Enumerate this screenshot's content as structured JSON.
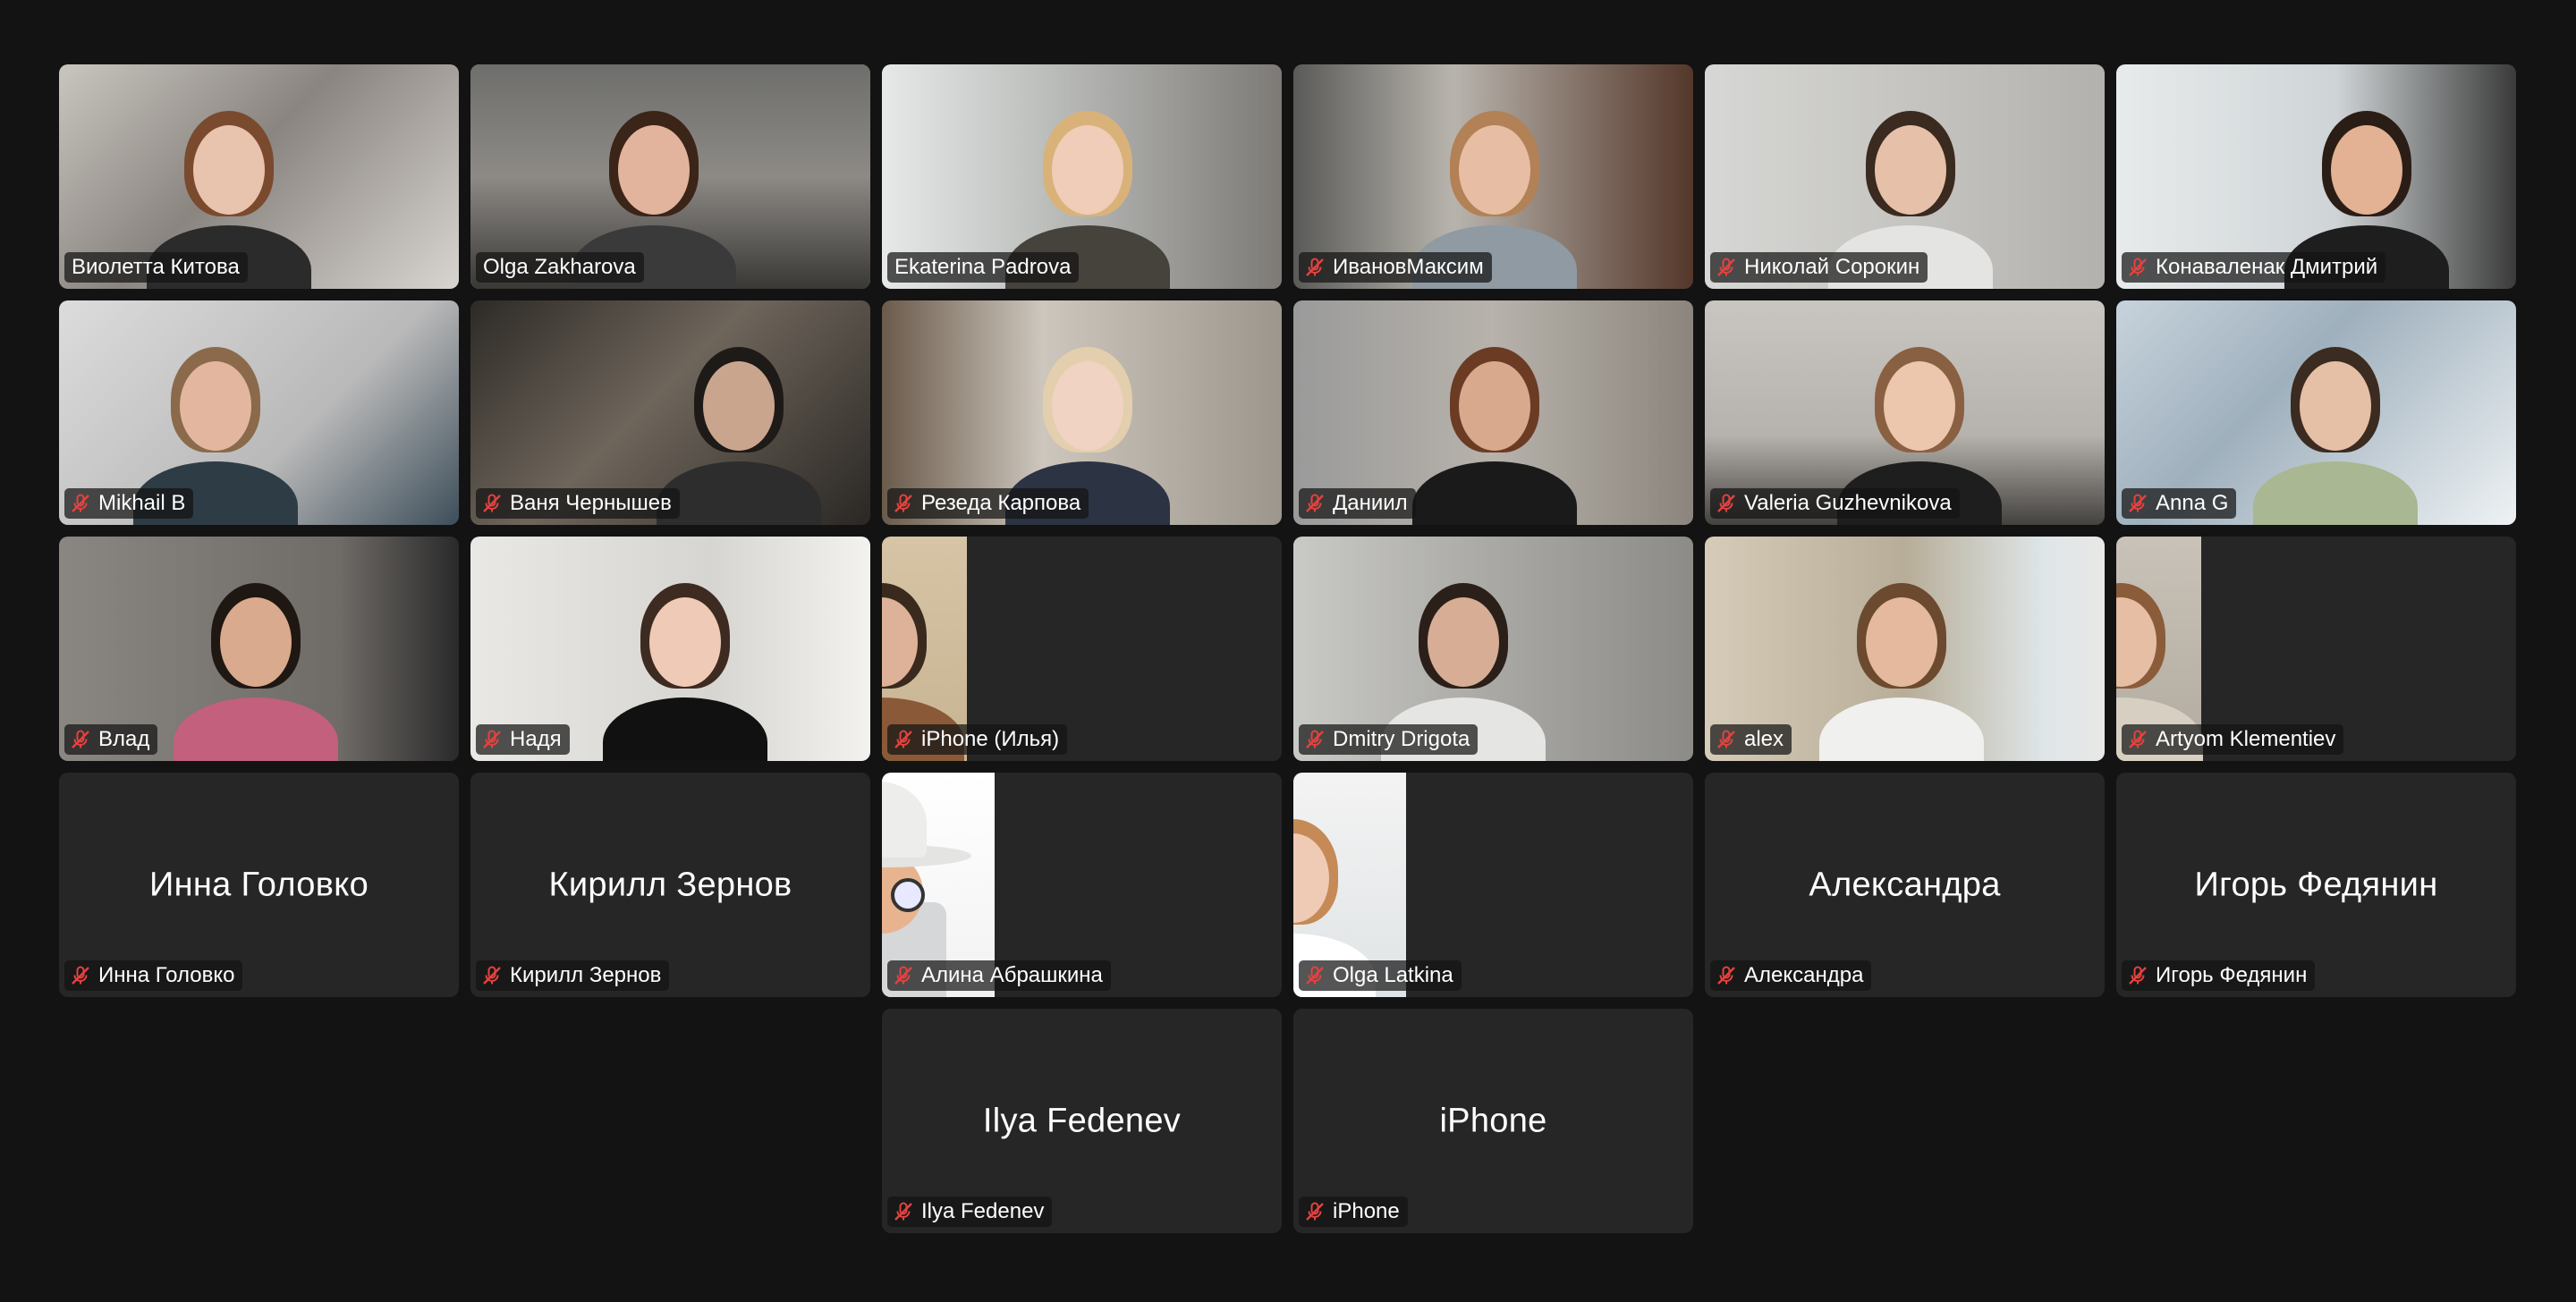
{
  "app": {
    "view": "gallery",
    "active_speaker_color": "#5bd35d",
    "muted_icon_color": "#e5423f"
  },
  "participants": [
    {
      "name": "Виолетта Китова",
      "muted": false,
      "video": true,
      "active": false,
      "icon": "none"
    },
    {
      "name": "Olga Zakharova",
      "muted": false,
      "video": true,
      "active": true,
      "icon": "none"
    },
    {
      "name": "Ekaterina Padrova",
      "muted": false,
      "video": true,
      "active": false,
      "icon": "none"
    },
    {
      "name": "ИвановМаксим",
      "muted": true,
      "video": true,
      "active": false,
      "icon": "mic-off-icon"
    },
    {
      "name": "Николай Сорокин",
      "muted": true,
      "video": true,
      "active": false,
      "icon": "mic-off-icon"
    },
    {
      "name": "Конаваленак Дмитрий",
      "muted": true,
      "video": true,
      "active": false,
      "icon": "mic-off-icon"
    },
    {
      "name": "Mikhail B",
      "muted": true,
      "video": true,
      "active": false,
      "icon": "mic-off-icon"
    },
    {
      "name": "Ваня Чернышев",
      "muted": true,
      "video": true,
      "active": false,
      "icon": "mic-off-icon"
    },
    {
      "name": "Резеда Карпова",
      "muted": true,
      "video": true,
      "active": false,
      "icon": "mic-off-icon"
    },
    {
      "name": "Даниил",
      "muted": true,
      "video": true,
      "active": false,
      "icon": "mic-off-icon"
    },
    {
      "name": "Valeria Guzhevnikova",
      "muted": true,
      "video": true,
      "active": false,
      "icon": "mic-off-icon"
    },
    {
      "name": "Anna G",
      "muted": true,
      "video": true,
      "active": false,
      "icon": "mic-off-icon"
    },
    {
      "name": "Влад",
      "muted": true,
      "video": true,
      "active": false,
      "icon": "mic-off-icon"
    },
    {
      "name": "Надя",
      "muted": true,
      "video": true,
      "active": false,
      "icon": "mic-off-icon"
    },
    {
      "name": "iPhone (Илья)",
      "muted": true,
      "video": true,
      "active": false,
      "icon": "mic-off-icon"
    },
    {
      "name": "Dmitry Drigota",
      "muted": true,
      "video": true,
      "active": false,
      "icon": "mic-off-icon"
    },
    {
      "name": "alex",
      "muted": true,
      "video": true,
      "active": false,
      "icon": "mic-off-icon"
    },
    {
      "name": "Artyom Klementiev",
      "muted": true,
      "video": true,
      "active": false,
      "icon": "mic-off-icon"
    },
    {
      "name": "Инна Головко",
      "muted": true,
      "video": false,
      "active": false,
      "icon": "mic-off-icon"
    },
    {
      "name": "Кирилл Зернов",
      "muted": true,
      "video": false,
      "active": false,
      "icon": "mic-off-icon"
    },
    {
      "name": "Алина Абрашкина",
      "muted": true,
      "video": true,
      "active": false,
      "icon": "mic-off-icon"
    },
    {
      "name": "Olga Latkina",
      "muted": true,
      "video": true,
      "active": false,
      "icon": "mic-off-icon"
    },
    {
      "name": "Александра",
      "muted": true,
      "video": false,
      "active": false,
      "icon": "mic-off-icon"
    },
    {
      "name": "Игорь Федянин",
      "muted": true,
      "video": false,
      "active": false,
      "icon": "mic-off-icon"
    },
    {
      "name": "Ilya Fedenev",
      "muted": true,
      "video": false,
      "active": false,
      "icon": "mic-off-icon"
    },
    {
      "name": "iPhone",
      "muted": true,
      "video": false,
      "active": false,
      "icon": "mic-off-icon"
    }
  ]
}
